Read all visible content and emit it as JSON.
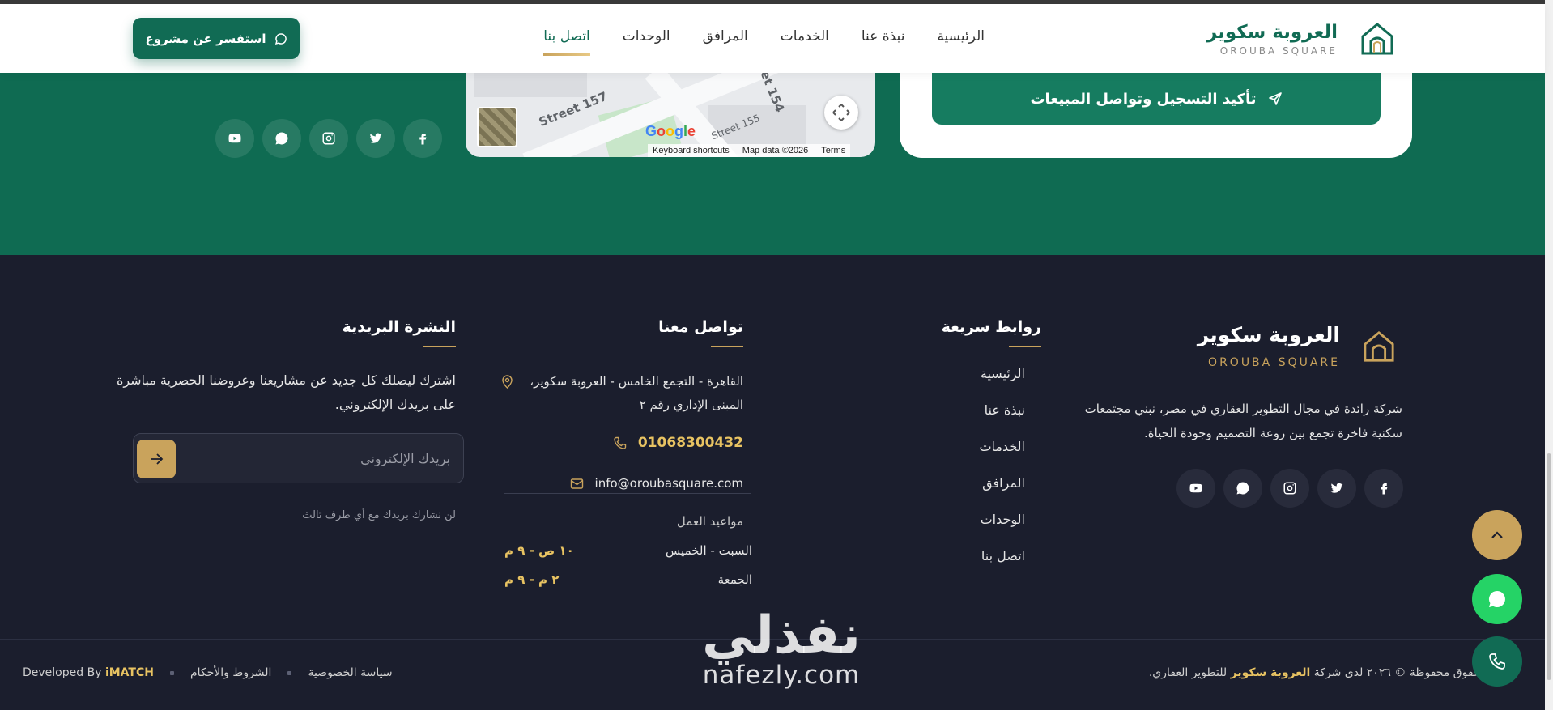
{
  "header": {
    "logo_ar": "العروبة سكوير",
    "logo_en": "OROUBA SQUARE",
    "nav": [
      {
        "label": "الرئيسية"
      },
      {
        "label": "نبذة عنا"
      },
      {
        "label": "الخدمات"
      },
      {
        "label": "المرافق"
      },
      {
        "label": "الوحدات"
      },
      {
        "label": "اتصل بنا",
        "active": true
      }
    ],
    "inquire_button": "استفسر عن مشروع"
  },
  "form": {
    "confirm_button": "تأكيد التسجيل وتواصل المبيعات"
  },
  "map": {
    "street_labels": [
      "Street 157",
      "Street 155",
      "et 154"
    ],
    "google": "Google",
    "keyboard_shortcuts": "Keyboard shortcuts",
    "map_data": "Map data ©2026",
    "terms": "Terms"
  },
  "social_icons": [
    "facebook-icon",
    "twitter-icon",
    "instagram-icon",
    "chat-bubble-icon",
    "youtube-icon"
  ],
  "footer": {
    "brand_ar": "العروبة سكوير",
    "brand_en": "OROUBA SQUARE",
    "about": "شركة رائدة في مجال التطوير العقاري في مصر، نبني مجتمعات سكنية فاخرة تجمع بين روعة التصميم وجودة الحياة.",
    "quick_links_title": "روابط سريعة",
    "quick_links": [
      "الرئيسية",
      "نبذة عنا",
      "الخدمات",
      "المرافق",
      "الوحدات",
      "اتصل بنا"
    ],
    "contact_title": "تواصل معنا",
    "address": "القاهرة - التجمع الخامس - العروبة سكوير، المبنى الإداري رقم ٢",
    "phone": "01068300432",
    "email": "info@oroubasquare.com",
    "hours_title": "مواعيد العمل",
    "hours": [
      {
        "day": "السبت - الخميس",
        "time": "١٠ ص - ٩ م"
      },
      {
        "day": "الجمعة",
        "time": "٢ م - ٩ م"
      }
    ],
    "newsletter_title": "النشرة البريدية",
    "newsletter_text": "اشترك ليصلك كل جديد عن مشاريعنا وعروضنا الحصرية مباشرة على بريدك الإلكتروني.",
    "newsletter_placeholder": "بريدك الإلكتروني",
    "newsletter_note": "لن نشارك بريدك مع أي طرف ثالث",
    "copyright_prefix": "جميع الحقوق محفوظة © ٢٠٢٦ لدى شركة",
    "copyright_brand": "العروبة سكوير",
    "copyright_suffix": "للتطوير العقاري.",
    "privacy": "سياسة الخصوصية",
    "terms": "الشروط والأحكام",
    "developed_by": "Developed By",
    "developer": "iMATCH"
  },
  "watermark": {
    "ar": "نفذلي",
    "en": "nafezly.com"
  },
  "colors": {
    "primary_green": "#116b54",
    "gold": "#c9a35c",
    "footer_bg": "#1b1e2d",
    "whatsapp": "#25d366"
  }
}
